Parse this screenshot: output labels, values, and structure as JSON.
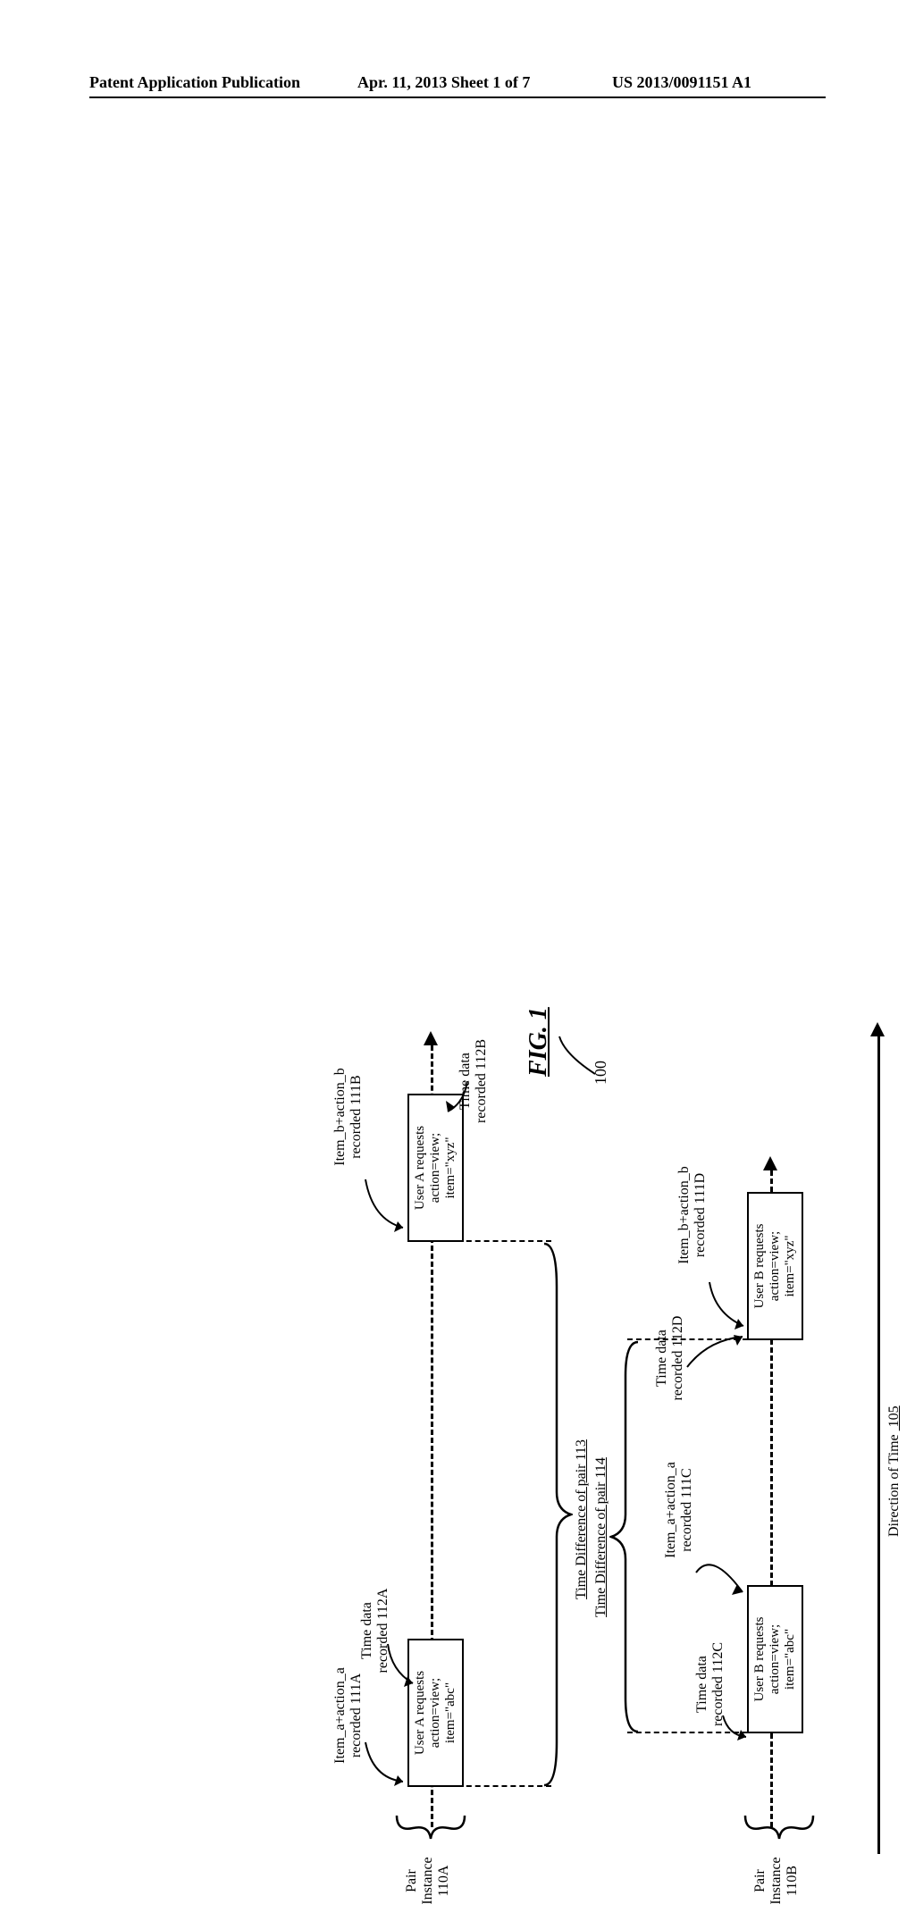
{
  "header": {
    "left": "Patent Application Publication",
    "mid": "Apr. 11, 2013  Sheet 1 of 7",
    "right": "US 2013/0091151 A1"
  },
  "figure": {
    "title": "FIG. 1",
    "refnum": "100",
    "direction_of_time": "Direction of Time 105",
    "pairA": {
      "label": "Pair\nInstance\n110A",
      "left": {
        "item_label": "Item_a+action_a\nrecorded 111A",
        "time_label": "Time data\nrecorded 112A",
        "box1": "User A requests",
        "box2": "action=view; item=\"abc\""
      },
      "right": {
        "item_label": "Item_b+action_b\nrecorded 111B",
        "time_label": "Time data\nrecorded 112B",
        "box1": "User A requests",
        "box2": "action=view; item=\"xyz\""
      },
      "time_diff": "Time Difference of pair 113"
    },
    "pairB": {
      "label": "Pair\nInstance\n110B",
      "left": {
        "item_label": "Item_a+action_a\nrecorded 111C",
        "time_label": "Time data\nrecorded 112C",
        "box1": "User B requests",
        "box2": "action=view; item=\"abc\""
      },
      "right": {
        "item_label": "Item_b+action_b\nrecorded 111D",
        "time_label": "Time data\nrecorded 112D",
        "box1": "User B requests",
        "box2": "action=view; item=\"xyz\""
      },
      "time_diff": "Time Difference of pair 114"
    }
  }
}
